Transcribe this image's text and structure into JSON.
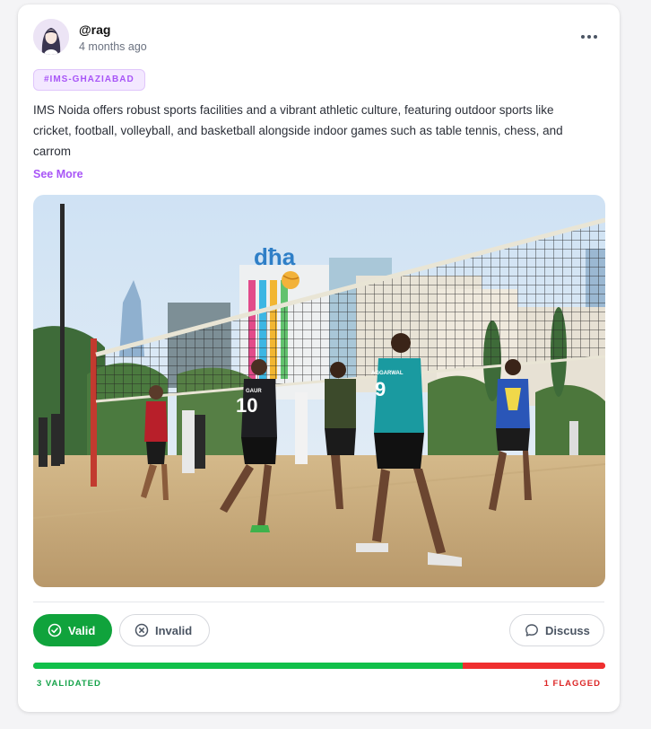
{
  "post": {
    "username": "@rag",
    "timestamp": "4 months ago",
    "tag": "#IMS-GHAZIABAD",
    "body": "IMS Noida offers robust sports facilities and a vibrant athletic culture, featuring outdoor sports like cricket, football, volleyball, and basketball alongside indoor games such as table tennis, chess, and carrom",
    "see_more": "See More",
    "photo": {
      "building_sign": "dħa",
      "jersey_left": "10",
      "jersey_left_name": "GAUR",
      "jersey_center": "9",
      "jersey_center_name": "AGGARWAL"
    }
  },
  "actions": {
    "valid_label": "Valid",
    "invalid_label": "Invalid",
    "discuss_label": "Discuss"
  },
  "validation": {
    "validated_label": "3 VALIDATED",
    "flagged_label": "1 FLAGGED",
    "validated_fraction": 0.75,
    "colors": {
      "validated": "#10c04a",
      "flagged": "#ef2f2f",
      "accent": "#a855f7"
    }
  }
}
